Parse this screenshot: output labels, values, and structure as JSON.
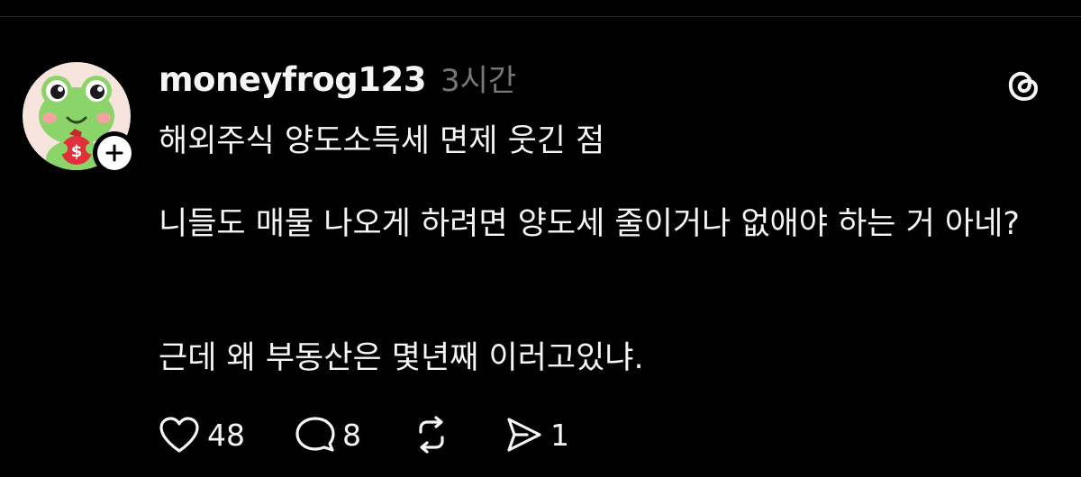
{
  "post": {
    "username": "moneyfrog123",
    "timestamp": "3시간",
    "title": "해외주식 양도소득세 면제 웃긴 점",
    "body_1": "니들도 매물 나오게 하려면 양도세 줄이거나 없애야 하는 거 아네?",
    "body_2": "근데 왜 부동산은 몇년째 이러고있냐."
  },
  "actions": {
    "likes": "48",
    "comments": "8",
    "reposts": "",
    "shares": "1"
  },
  "icons": {
    "avatar": "frog-avatar-icon",
    "follow": "plus-icon",
    "menu": "threads-logo-icon",
    "like": "heart-icon",
    "comment": "comment-bubble-icon",
    "repost": "repost-icon",
    "share": "send-icon"
  },
  "colors": {
    "background": "#000000",
    "text": "#f3f5f7",
    "muted": "#777777",
    "avatar_bg": "#f6e4dd",
    "frog_green": "#8bd46a",
    "money_bag": "#e0303a"
  }
}
